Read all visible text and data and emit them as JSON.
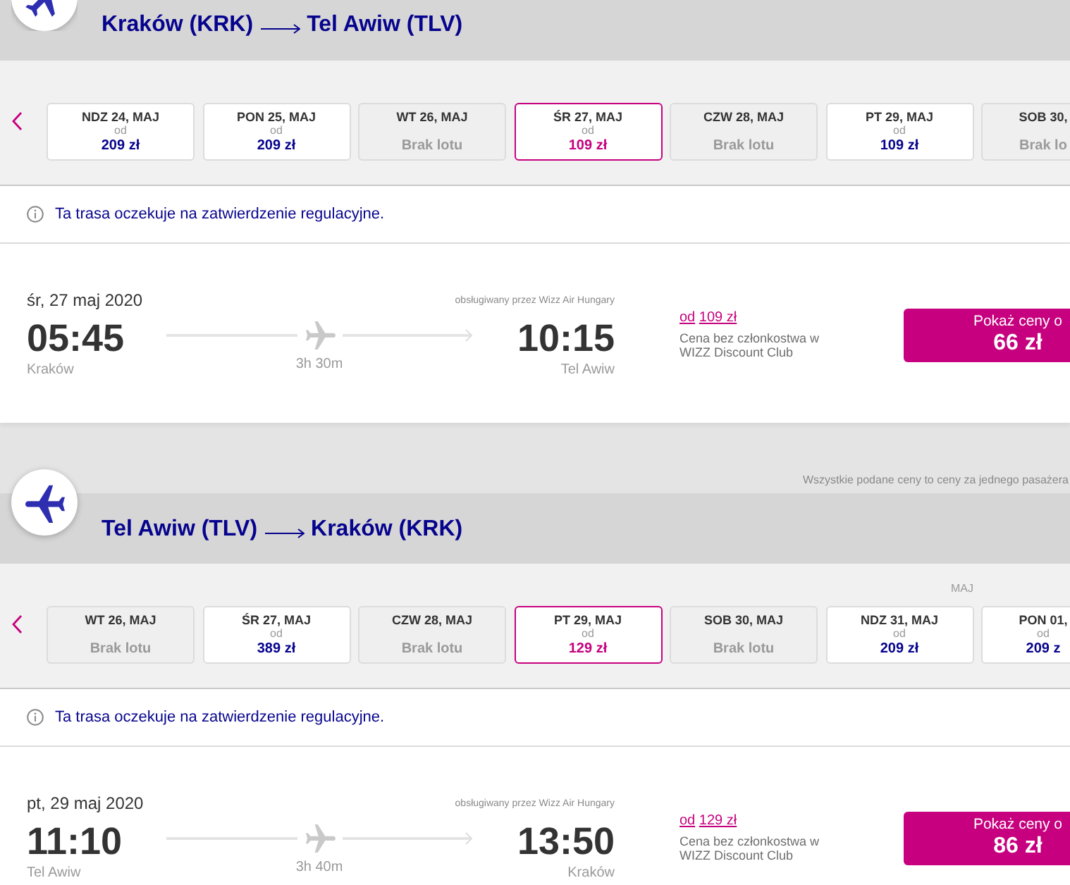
{
  "outbound": {
    "route": {
      "origin": "Kraków (KRK)",
      "destination": "Tel Awiw (TLV)"
    },
    "days": [
      {
        "kind": "price",
        "label": "NDZ 24, MAJ",
        "prefix": "od",
        "price": "209 zł",
        "selected": false
      },
      {
        "kind": "price",
        "label": "PON 25, MAJ",
        "prefix": "od",
        "price": "209 zł",
        "selected": false
      },
      {
        "kind": "no_flight",
        "label": "WT 26, MAJ",
        "status": "Brak lotu",
        "selected": false
      },
      {
        "kind": "price",
        "label": "ŚR 27, MAJ",
        "prefix": "od",
        "price": "109 zł",
        "selected": true
      },
      {
        "kind": "no_flight",
        "label": "CZW 28, MAJ",
        "status": "Brak lotu",
        "selected": false
      },
      {
        "kind": "price",
        "label": "PT 29, MAJ",
        "prefix": "od",
        "price": "109 zł",
        "selected": false
      },
      {
        "kind": "no_flight",
        "label": "SOB 30,",
        "status": "Brak lo",
        "selected": false
      }
    ],
    "notice": "Ta trasa oczekuje na zatwierdzenie regulacyjne.",
    "flight": {
      "date": "śr, 27 maj 2020",
      "operator": "obsługiwany przez Wizz Air Hungary",
      "departure_time": "05:45",
      "departure_city": "Kraków",
      "duration": "3h 30m",
      "arrival_time": "10:15",
      "arrival_city": "Tel Awiw",
      "fare": {
        "prefix": "od",
        "price": "109 zł"
      },
      "fare_note": [
        "Cena bez członkostwa w",
        "WIZZ Discount Club"
      ],
      "button": {
        "label": "Pokaż ceny o",
        "price": "66 zł"
      }
    }
  },
  "price_note": "Wszystkie podane ceny to ceny za jednego pasażera",
  "return": {
    "route": {
      "origin": "Tel Awiw (TLV)",
      "destination": "Kraków (KRK)"
    },
    "days": [
      {
        "kind": "no_flight",
        "label": "WT 26, MAJ",
        "status": "Brak lotu",
        "selected": false
      },
      {
        "kind": "price",
        "label": "ŚR 27, MAJ",
        "prefix": "od",
        "price": "389 zł",
        "selected": false
      },
      {
        "kind": "no_flight",
        "label": "CZW 28, MAJ",
        "status": "Brak lotu",
        "selected": false
      },
      {
        "kind": "price",
        "label": "PT 29, MAJ",
        "prefix": "od",
        "price": "129 zł",
        "selected": true
      },
      {
        "kind": "no_flight",
        "label": "SOB 30, MAJ",
        "status": "Brak lotu",
        "selected": false
      },
      {
        "kind": "price",
        "label": "NDZ 31, MAJ",
        "month": "MAJ",
        "prefix": "od",
        "price": "209 zł",
        "selected": false
      },
      {
        "kind": "price",
        "label": "PON 01,",
        "prefix": "od",
        "price": "209 z",
        "selected": false
      }
    ],
    "notice": "Ta trasa oczekuje na zatwierdzenie regulacyjne.",
    "flight": {
      "date": "pt, 29 maj 2020",
      "operator": "obsługiwany przez Wizz Air Hungary",
      "departure_time": "11:10",
      "departure_city": "Tel Awiw",
      "duration": "3h 40m",
      "arrival_time": "13:50",
      "arrival_city": "Kraków",
      "fare": {
        "prefix": "od",
        "price": "129 zł"
      },
      "fare_note": [
        "Cena bez członkostwa w",
        "WIZZ Discount Club"
      ],
      "button": {
        "label": "Pokaż ceny o",
        "price": "86 zł"
      }
    }
  }
}
